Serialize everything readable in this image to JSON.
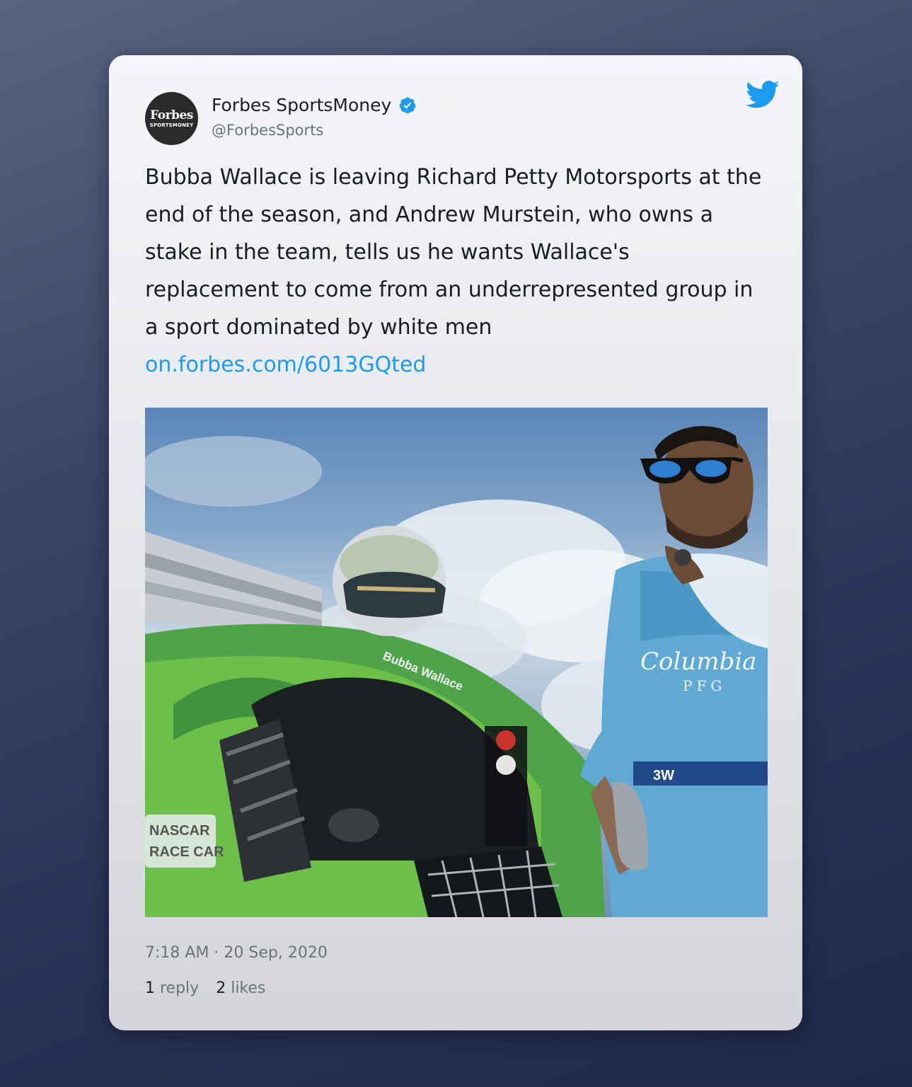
{
  "tweet": {
    "avatar": {
      "brand": "Forbes",
      "sub": "SPORTSMONEY"
    },
    "display_name": "Forbes SportsMoney",
    "handle": "@ForbesSports",
    "verified": true,
    "text": "Bubba Wallace is leaving Richard Petty Motorsports at the end of the season, and Andrew Murstein, who owns a stake in the team, tells us he wants Wallace's replacement to come from an underrepresented group in a sport dominated by white men",
    "link": "on.forbes.com/6013GQted",
    "timestamp": "7:18 AM · 20 Sep, 2020",
    "replies": {
      "count": "1",
      "label": "reply"
    },
    "likes": {
      "count": "2",
      "label": "likes"
    },
    "photo_text": {
      "name_on_car": "Bubba Wallace",
      "suit_sponsor": "Columbia",
      "suit_sponsor_sub": "PFG",
      "belt_logo": "3W",
      "car_sign_line1": "NASCAR",
      "car_sign_line2": "RACE CAR"
    }
  },
  "colors": {
    "link": "#1d9bf0",
    "twitter_brand": "#1d9bf0",
    "verified": "#1d9bf0"
  }
}
